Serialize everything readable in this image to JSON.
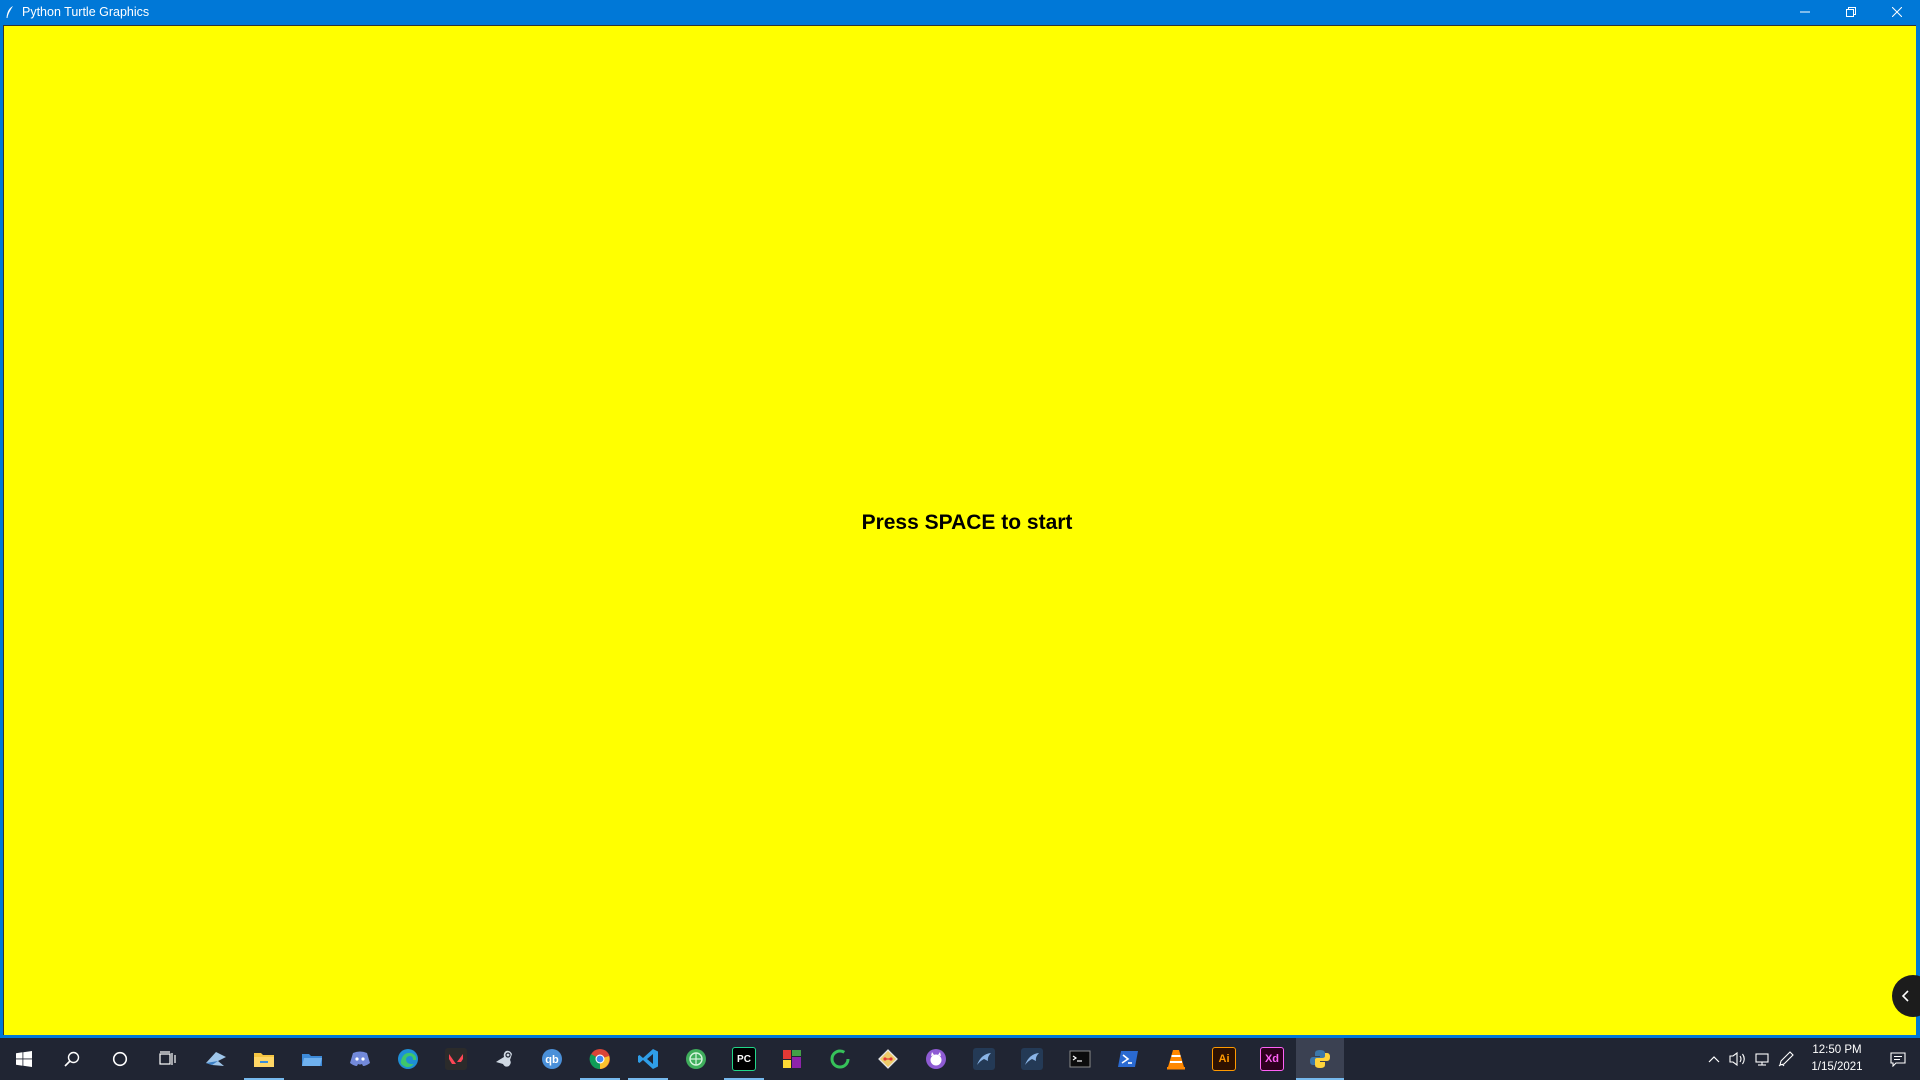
{
  "window": {
    "title": "Python Turtle Graphics",
    "background_color": "#ffff00",
    "titlebar_color": "#0078d7"
  },
  "canvas": {
    "message": "Press SPACE to start"
  },
  "taskbar": {
    "pinned_apps": [
      {
        "name": "start-icon"
      },
      {
        "name": "search-icon"
      },
      {
        "name": "cortana-icon"
      },
      {
        "name": "task-view-icon"
      },
      {
        "name": "app-blue-bird-icon"
      },
      {
        "name": "file-explorer-icon",
        "running": true
      },
      {
        "name": "app-blue-folder-icon"
      },
      {
        "name": "discord-icon"
      },
      {
        "name": "edge-icon"
      },
      {
        "name": "valorant-icon"
      },
      {
        "name": "steam-icon"
      },
      {
        "name": "qbittorrent-icon"
      },
      {
        "name": "chrome-icon",
        "running": true
      },
      {
        "name": "vscode-icon",
        "running": true
      },
      {
        "name": "app-green-globe-icon"
      },
      {
        "name": "pycharm-icon",
        "running": true
      },
      {
        "name": "app-colorblocks-icon"
      },
      {
        "name": "app-green-ring-icon"
      },
      {
        "name": "git-icon"
      },
      {
        "name": "app-purple-cat-icon"
      },
      {
        "name": "app-dolphin-icon"
      },
      {
        "name": "app-dolphin-2-icon"
      },
      {
        "name": "terminal-icon"
      },
      {
        "name": "powershell-icon"
      },
      {
        "name": "vlc-icon"
      },
      {
        "name": "illustrator-icon",
        "label": "Ai"
      },
      {
        "name": "xd-icon",
        "label": "Xd"
      },
      {
        "name": "python-icon",
        "active": true
      }
    ],
    "clock": {
      "time": "12:50 PM",
      "date": "1/15/2021"
    }
  }
}
